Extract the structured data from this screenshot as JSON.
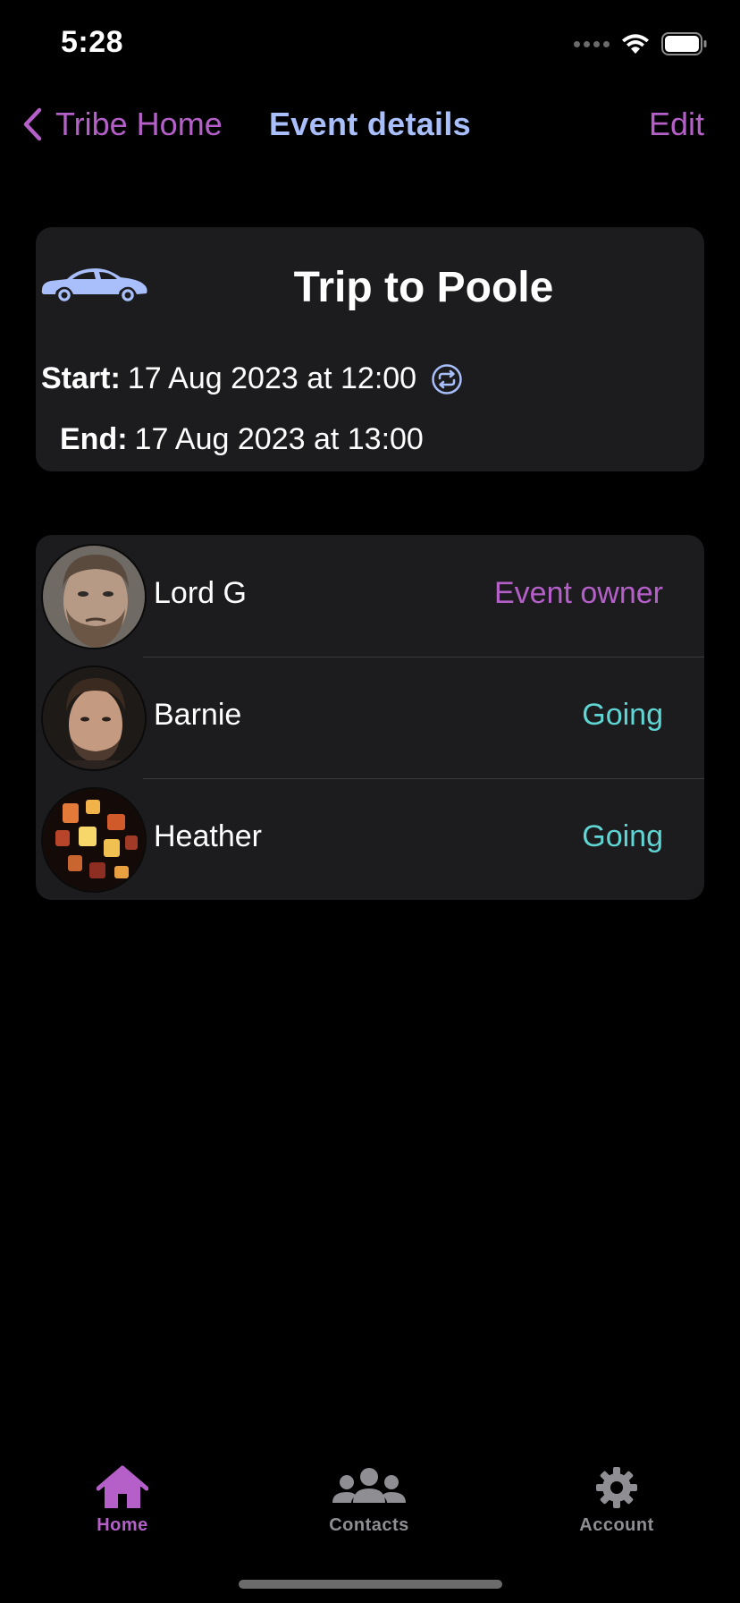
{
  "status_bar": {
    "time": "5:28",
    "icons": [
      "signal-icon",
      "wifi-icon",
      "battery-icon"
    ]
  },
  "nav": {
    "back_label": "Tribe Home",
    "title": "Event details",
    "edit_label": "Edit"
  },
  "event": {
    "icon": "car-icon",
    "title": "Trip to Poole",
    "start_label": "Start:",
    "start_value": "17 Aug 2023 at 12:00",
    "end_label": "End:",
    "end_value": "17 Aug 2023 at 13:00",
    "repeat_icon": "repeat-icon"
  },
  "attendees": [
    {
      "name": "Lord G",
      "status": "Event owner"
    },
    {
      "name": "Barnie",
      "status": "Going"
    },
    {
      "name": "Heather",
      "status": "Going"
    }
  ],
  "tabs": [
    {
      "label": "Home",
      "icon": "home-icon",
      "selected": true
    },
    {
      "label": "Contacts",
      "icon": "people-icon",
      "selected": false
    },
    {
      "label": "Account",
      "icon": "gear-icon",
      "selected": false
    }
  ],
  "colors": {
    "background": "#000000",
    "card": "#1c1c1e",
    "accent_purple": "#b55fc9",
    "title_blue": "#a9bffc",
    "going_teal": "#5fd6d4",
    "inactive_gray": "#8e8e93"
  }
}
